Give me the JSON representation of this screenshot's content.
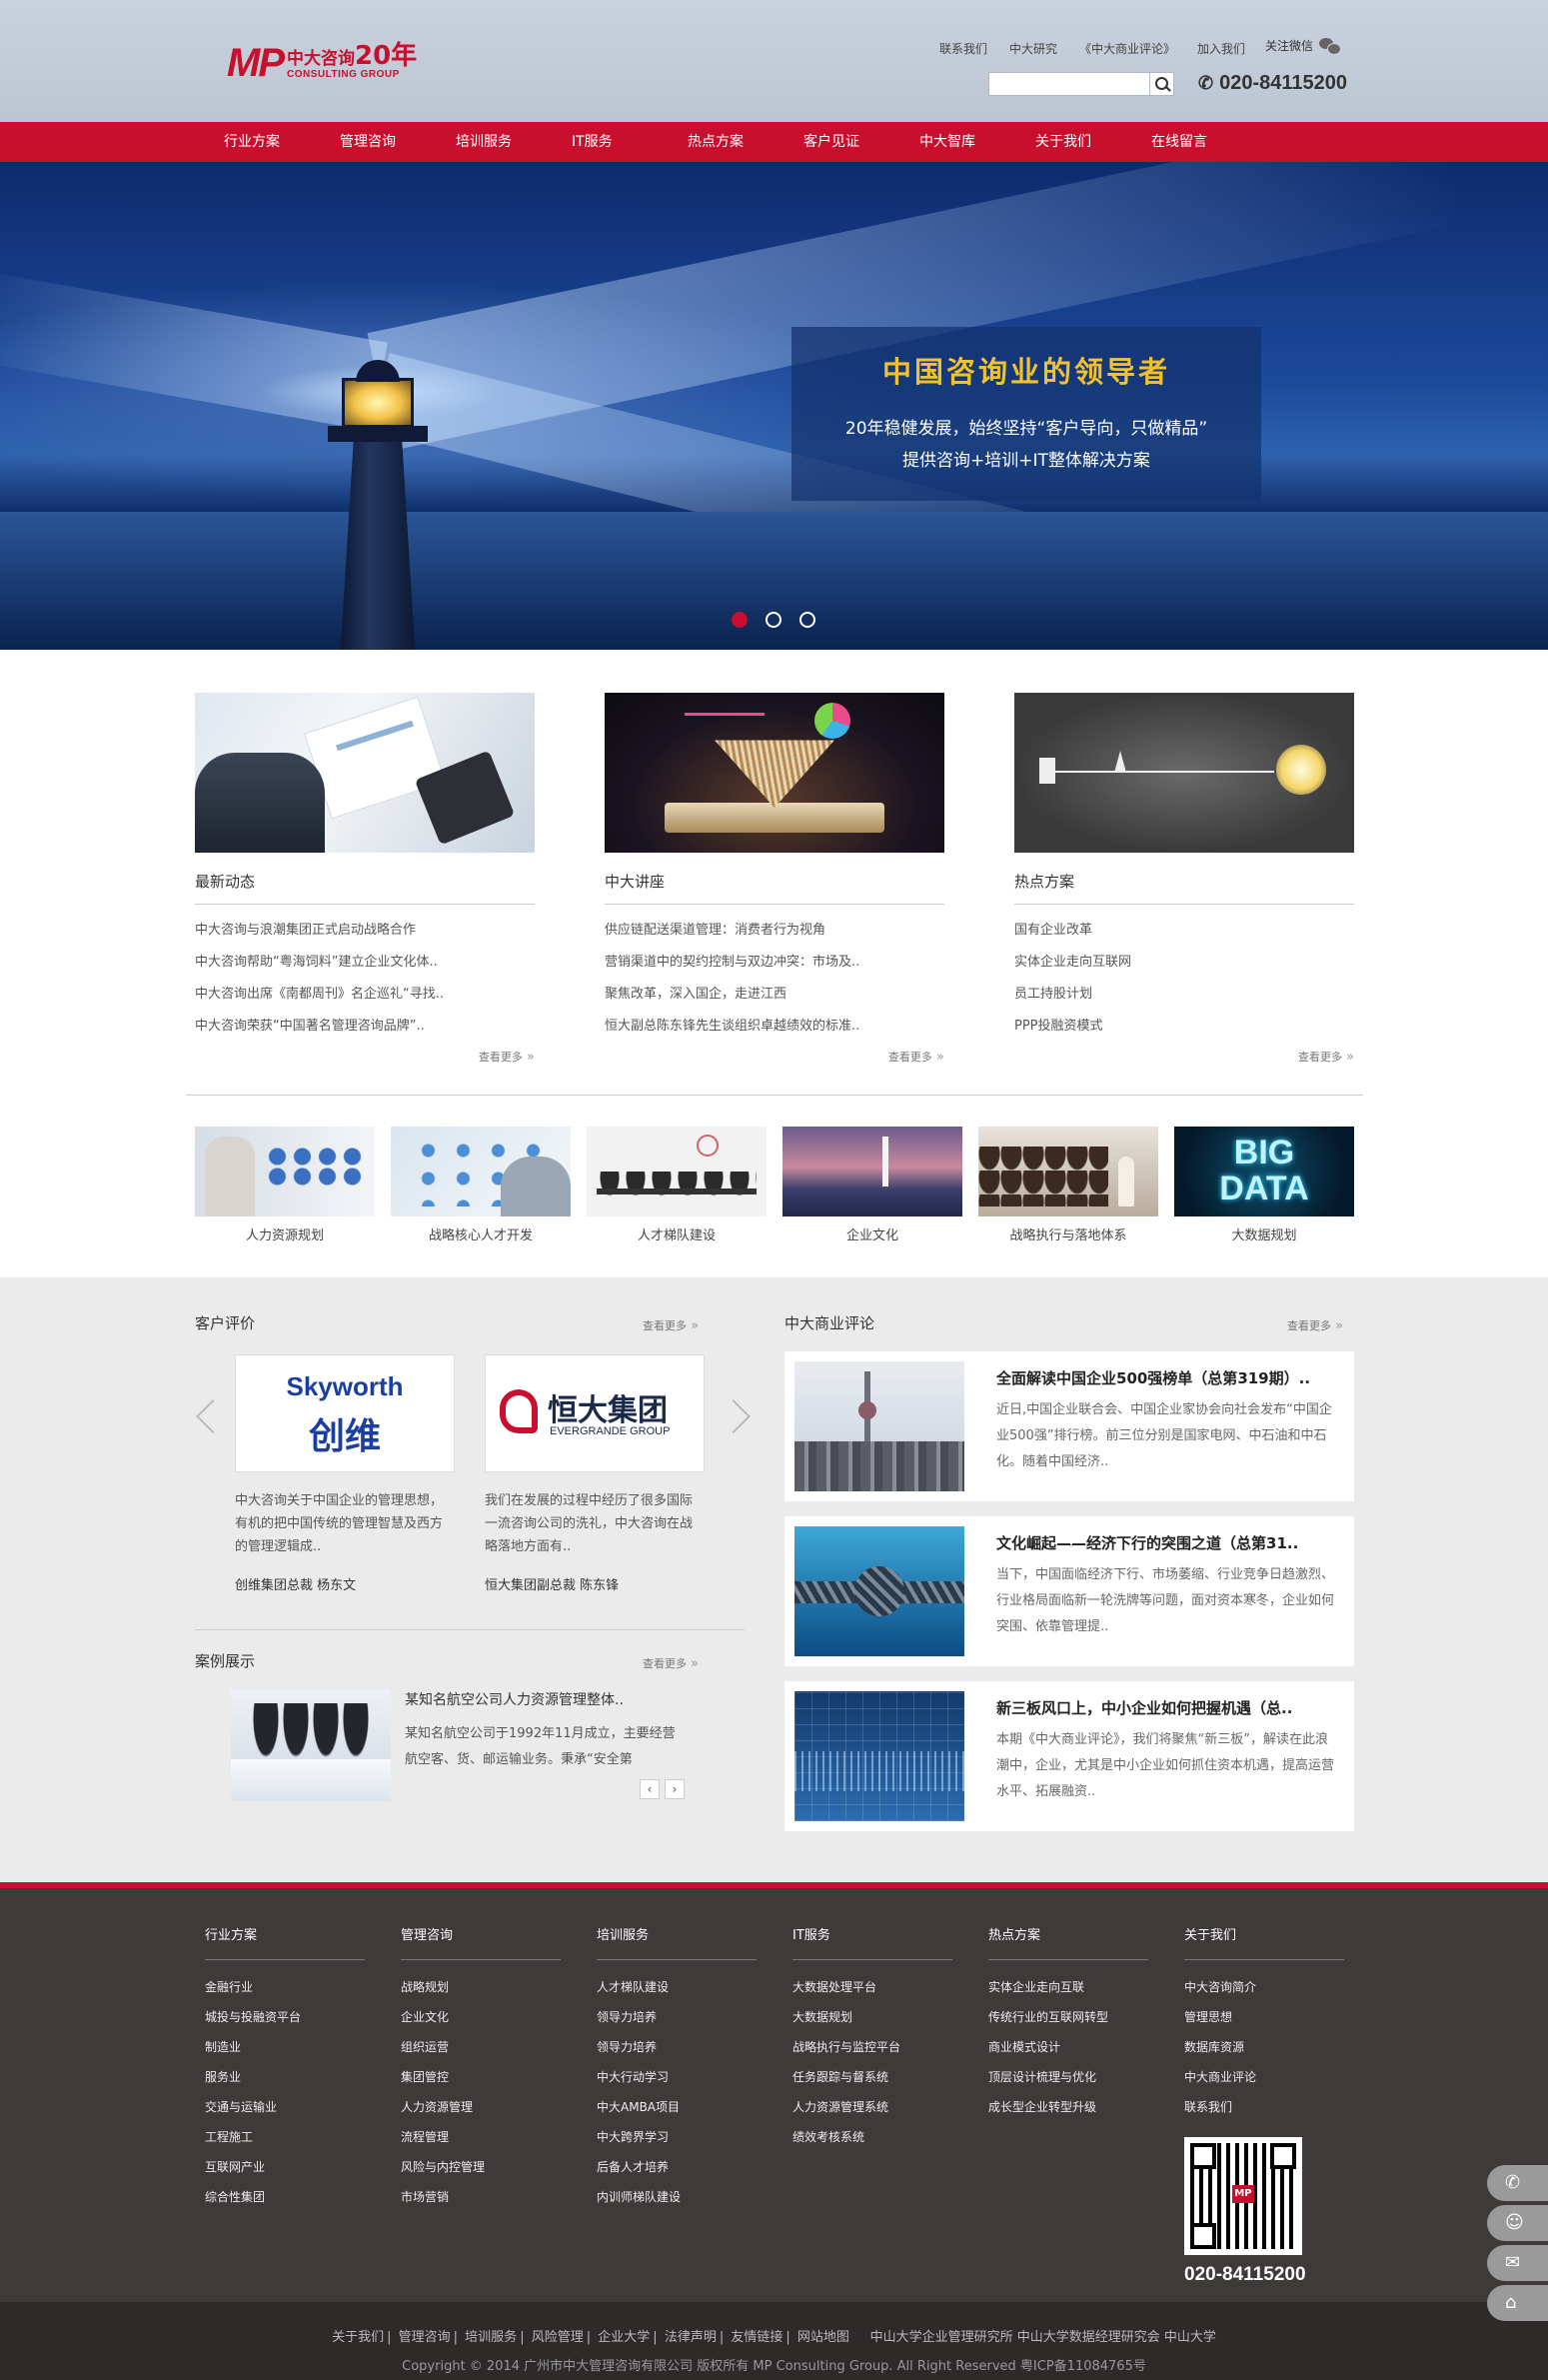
{
  "header": {
    "logo_mp": "MP",
    "logo_cn": "中大咨询",
    "logo_num": "20年",
    "logo_en": "CONSULTING GROUP",
    "links": [
      "联系我们",
      "中大研究",
      "《中大商业评论》",
      "加入我们"
    ],
    "wechat": "关注微信",
    "search_placeholder": "",
    "hotline": "020-84115200"
  },
  "nav": [
    "行业方案",
    "管理咨询",
    "培训服务",
    "IT服务",
    "热点方案",
    "客户见证",
    "中大智库",
    "关于我们",
    "在线留言"
  ],
  "banner": {
    "title": "中国咨询业的领导者",
    "line1": "20年稳健发展，始终坚持“客户导向，只做精品”",
    "line2": "提供咨询+培训+IT整体解决方案",
    "slides": 3,
    "active_slide": 1
  },
  "columns": [
    {
      "title": "最新动态",
      "items": [
        "中大咨询与浪潮集团正式启动战略合作",
        "中大咨询帮助“粤海饲料”建立企业文化体..",
        "中大咨询出席《南都周刊》名企巡礼“寻找..",
        "中大咨询荣获“中国著名管理咨询品牌”.."
      ],
      "more": "查看更多"
    },
    {
      "title": "中大讲座",
      "items": [
        "供应链配送渠道管理：消费者行为视角",
        "营销渠道中的契约控制与双边冲突：市场及..",
        "聚焦改革，深入国企，走进江西",
        "恒大副总陈东锋先生谈组织卓越绩效的标准.."
      ],
      "more": "查看更多"
    },
    {
      "title": "热点方案",
      "items": [
        "国有企业改革",
        "实体企业走向互联网",
        "员工持股计划",
        "PPP投融资模式"
      ],
      "more": "查看更多"
    }
  ],
  "thumbs": [
    "人力资源规划",
    "战略核心人才开发",
    "人才梯队建设",
    "企业文化",
    "战略执行与落地体系",
    "大数据规划"
  ],
  "thumb_big_data_text": "BIG DATA",
  "clients": {
    "title": "客户评价",
    "more": "查看更多",
    "items": [
      {
        "logo_en": "Skyworth",
        "logo_cn": "创维",
        "desc": "中大咨询关于中国企业的管理思想，有机的把中国传统的管理智慧及西方的管理逻辑成..",
        "name": "创维集团总裁 杨东文"
      },
      {
        "logo_en": "EVERGRANDE GROUP",
        "logo_cn": "恒大集团",
        "desc": "我们在发展的过程中经历了很多国际一流咨询公司的洗礼，中大咨询在战略落地方面有..",
        "name": "恒大集团副总裁 陈东锋"
      }
    ]
  },
  "cases": {
    "title": "案例展示",
    "more": "查看更多",
    "case_title": "某知名航空公司人力资源管理整体..",
    "case_desc": "某知名航空公司于1992年11月成立，主要经营航空客、货、邮运输业务。秉承“安全第",
    "prev": "‹",
    "next": "›"
  },
  "reviews": {
    "title": "中大商业评论",
    "more": "查看更多",
    "items": [
      {
        "title": "全面解读中国企业500强榜单（总第319期）..",
        "desc": "近日,中国企业联合会、中国企业家协会向社会发布“中国企业500强”排行榜。前三位分别是国家电网、中石油和中石化。随着中国经济.."
      },
      {
        "title": "文化崛起——经济下行的突围之道（总第31..",
        "desc": "当下，中国面临经济下行、市场萎缩、行业竞争日趋激烈、行业格局面临新一轮洗牌等问题，面对资本寒冬，企业如何突围、依靠管理提.."
      },
      {
        "title": "新三板风口上，中小企业如何把握机遇（总..",
        "desc": "本期《中大商业评论》，我们将聚焦“新三板”，解读在此浪潮中，企业，尤其是中小企业如何抓住资本机遇，提高运营水平、拓展融资.."
      }
    ]
  },
  "footer": {
    "columns": [
      {
        "title": "行业方案",
        "items": [
          "金融行业",
          "城投与投融资平台",
          "制造业",
          "服务业",
          "交通与运输业",
          "工程施工",
          "互联网产业",
          "综合性集团"
        ]
      },
      {
        "title": "管理咨询",
        "items": [
          "战略规划",
          "企业文化",
          "组织运营",
          "集团管控",
          "人力资源管理",
          "流程管理",
          "风险与内控管理",
          "市场营销"
        ]
      },
      {
        "title": "培训服务",
        "items": [
          "人才梯队建设",
          "领导力培养",
          "领导力培养",
          "中大行动学习",
          "中大AMBA项目",
          "中大跨界学习",
          "后备人才培养",
          "内训师梯队建设"
        ]
      },
      {
        "title": "IT服务",
        "items": [
          "大数据处理平台",
          "大数据规划",
          "战略执行与监控平台",
          "任务跟踪与督系统",
          "人力资源管理系统",
          "绩效考核系统"
        ]
      },
      {
        "title": "热点方案",
        "items": [
          "实体企业走向互联",
          "传统行业的互联网转型",
          "商业模式设计",
          "顶层设计梳理与优化",
          "成长型企业转型升级"
        ]
      },
      {
        "title": "关于我们",
        "items": [
          "中大咨询简介",
          "管理思想",
          "数据库资源",
          "中大商业评论",
          "联系我们"
        ]
      }
    ],
    "phone": "020-84115200",
    "bottom_links": [
      "关于我们",
      "|",
      "管理咨询",
      "|",
      "培训服务",
      "|",
      "风险管理",
      "|",
      "企业大学",
      "|",
      "法律声明",
      "|",
      "友情链接",
      "|",
      "网站地图",
      "中山大学企业管理研究所",
      "中山大学数据经理研究会",
      "中山大学"
    ],
    "copyright": "Copyright © 2014 广州市中大管理咨询有限公司 版权所有 MP Consulting Group. All Right Reserved 粤ICP备11084765号"
  },
  "side": [
    "✆",
    "☺",
    "✉",
    "⌂"
  ],
  "colors": {
    "brand_red": "#c8102e",
    "banner_gold": "#f2c12e",
    "footer_bg": "#3e3a39"
  }
}
